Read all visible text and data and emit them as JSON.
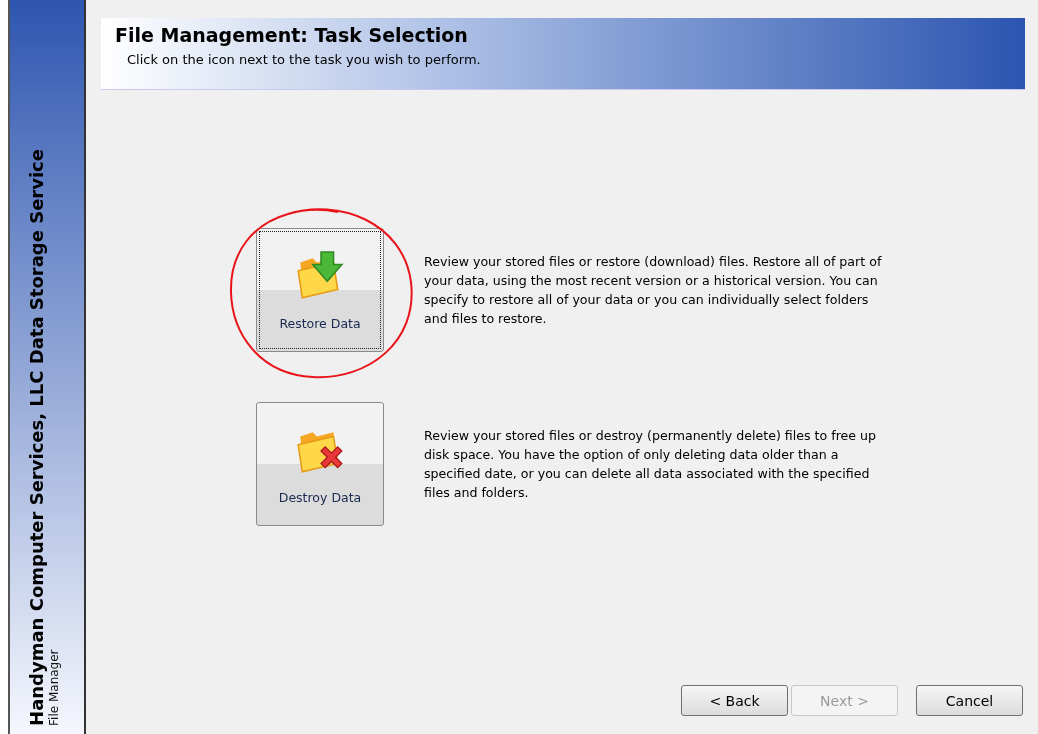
{
  "sidebar": {
    "title": "Handyman Computer Services, LLC Data Storage Service",
    "subtitle": "File Manager"
  },
  "header": {
    "title": "File Management: Task Selection",
    "subtitle": "Click on the icon next to the task you wish to perform."
  },
  "tasks": [
    {
      "label": "Restore Data",
      "kind": "restore",
      "focused": true,
      "circled": true,
      "description": "Review your stored files or restore (download) files. Restore all of part of your data, using the most recent version or a historical version. You can specify to restore all of your data or you can individually select folders and files to restore."
    },
    {
      "label": "Destroy Data",
      "kind": "destroy",
      "focused": false,
      "circled": false,
      "description": "Review your stored files or destroy (permanently delete) files to free up disk space. You have the option of only deleting data older than a specified date, or you can delete all data associated with the specified files and folders."
    }
  ],
  "buttons": [
    {
      "label": "< Back",
      "disabled": false
    },
    {
      "label": "Next >",
      "disabled": true
    },
    {
      "label": "Cancel",
      "disabled": false
    }
  ]
}
